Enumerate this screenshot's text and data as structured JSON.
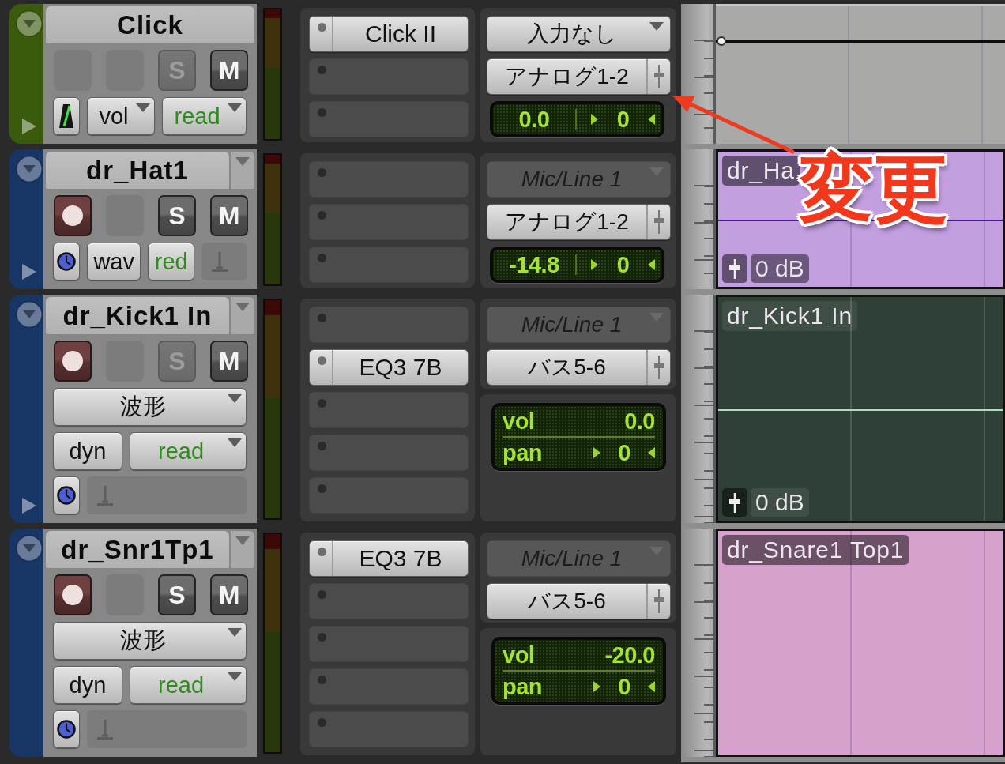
{
  "tracks": [
    {
      "name": "Click",
      "name_menu": false,
      "color": "#3a5a0c",
      "expand_arrow": true,
      "record_button": false,
      "solo": {
        "label": "S",
        "dimmed": true
      },
      "mute": {
        "label": "M"
      },
      "control_rows": [
        [
          {
            "kind": "metronome"
          },
          {
            "kind": "view",
            "label": "vol",
            "arrow": true
          },
          {
            "kind": "automation",
            "label": "read",
            "arrow": true
          }
        ]
      ],
      "inserts": [
        {
          "kind": "plugin",
          "label": "Click II"
        },
        {
          "kind": "empty"
        },
        {
          "kind": "empty"
        }
      ],
      "input": {
        "label": "入力なし",
        "inactive": false
      },
      "output": {
        "label": "アナログ1-2"
      },
      "mix": {
        "kind": "compact",
        "volume": "0.0",
        "pan": "0"
      },
      "lane": {
        "kind": "automation"
      }
    },
    {
      "name": "dr_Hat1",
      "name_menu": true,
      "color": "#173565",
      "expand_arrow": true,
      "record_button": true,
      "solo": {
        "label": "S",
        "dimmed": false
      },
      "mute": {
        "label": "M"
      },
      "control_rows": [
        [
          {
            "kind": "timebase"
          },
          {
            "kind": "view",
            "label": "wav",
            "arrow": false
          },
          {
            "kind": "automation",
            "label": "red",
            "arrow": false
          },
          {
            "kind": "stand"
          }
        ]
      ],
      "inserts": [
        {
          "kind": "empty"
        },
        {
          "kind": "empty"
        },
        {
          "kind": "empty"
        }
      ],
      "input": {
        "label": "Mic/Line 1",
        "inactive": true
      },
      "output": {
        "label": "アナログ1-2"
      },
      "mix": {
        "kind": "compact",
        "volume": "-14.8",
        "pan": "0"
      },
      "lane": {
        "kind": "clip",
        "color": "#c39fe0",
        "name": "dr_Ha",
        "gain": "0 dB",
        "center_line": true
      }
    },
    {
      "name": "dr_Kick1 In",
      "name_menu": true,
      "color": "#173565",
      "expand_arrow": true,
      "record_button": true,
      "solo": {
        "label": "S",
        "dimmed": true
      },
      "mute": {
        "label": "M"
      },
      "control_rows": [
        [
          {
            "kind": "view",
            "label": "波形",
            "arrow": true
          }
        ],
        [
          {
            "kind": "button",
            "label": "dyn"
          },
          {
            "kind": "automation",
            "label": "read",
            "arrow": true
          }
        ],
        [
          {
            "kind": "timebase"
          },
          {
            "kind": "stand"
          }
        ]
      ],
      "inserts": [
        {
          "kind": "empty"
        },
        {
          "kind": "plugin",
          "label": "EQ3 7B"
        },
        {
          "kind": "empty"
        },
        {
          "kind": "empty"
        },
        {
          "kind": "empty"
        }
      ],
      "input": {
        "label": "Mic/Line 1",
        "inactive": true
      },
      "output": {
        "label": "バス5-6"
      },
      "mix": {
        "kind": "labeled",
        "volume_label": "vol",
        "volume": "0.0",
        "pan_label": "pan",
        "pan": "0"
      },
      "lane": {
        "kind": "clip",
        "color": "#2f4136",
        "name": "dr_Kick1 In",
        "gain": "0 dB",
        "center_line": true
      }
    },
    {
      "name": "dr_Snr1Tp1",
      "name_menu": true,
      "color": "#173565",
      "expand_arrow": false,
      "record_button": true,
      "solo": {
        "label": "S",
        "dimmed": false
      },
      "mute": {
        "label": "M"
      },
      "control_rows": [
        [
          {
            "kind": "view",
            "label": "波形",
            "arrow": true
          }
        ],
        [
          {
            "kind": "button",
            "label": "dyn"
          },
          {
            "kind": "automation",
            "label": "read",
            "arrow": true
          }
        ],
        [
          {
            "kind": "timebase"
          },
          {
            "kind": "stand"
          }
        ]
      ],
      "inserts": [
        {
          "kind": "plugin",
          "label": "EQ3 7B"
        },
        {
          "kind": "empty"
        },
        {
          "kind": "empty"
        },
        {
          "kind": "empty"
        },
        {
          "kind": "empty"
        }
      ],
      "input": {
        "label": "Mic/Line 1",
        "inactive": true
      },
      "output": {
        "label": "バス5-6"
      },
      "mix": {
        "kind": "labeled",
        "volume_label": "vol",
        "volume": "-20.0",
        "pan_label": "pan",
        "pan": "0"
      },
      "lane": {
        "kind": "clip",
        "color": "#d6a1cc",
        "name": "dr_Snare1 Top1",
        "center_line": false
      }
    }
  ],
  "annotation": {
    "label": "変更"
  }
}
